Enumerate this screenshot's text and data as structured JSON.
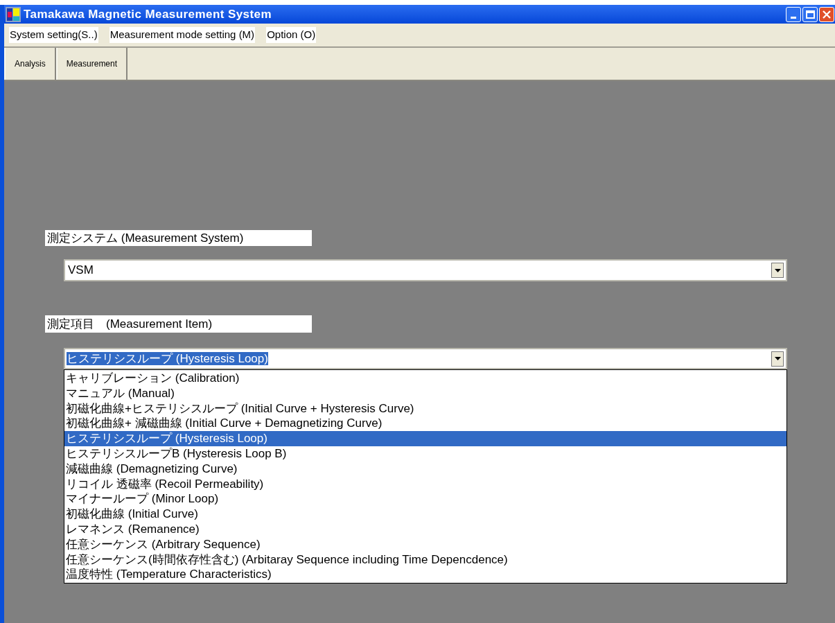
{
  "window": {
    "title": "Tamakawa Magnetic Measurement System"
  },
  "menu": [
    "System setting(S..)",
    "Measurement mode setting (M)",
    "Option (O)"
  ],
  "toolbar": [
    {
      "label": "Analysis",
      "selected": false
    },
    {
      "label": "Measurement",
      "selected": false
    }
  ],
  "measurement_system": {
    "label": "測定システム (Measurement System)",
    "value": "VSM"
  },
  "measurement_item": {
    "label": "測定項目　(Measurement Item)",
    "value": "ヒステリシスループ (Hysteresis Loop)",
    "expanded": true,
    "options": [
      {
        "label": "キャリブレーション (Calibration)",
        "selected": false
      },
      {
        "label": "マニュアル (Manual)",
        "selected": false
      },
      {
        "label": "初磁化曲線+ヒステリシスループ (Initial Curve + Hysteresis Curve)",
        "selected": false
      },
      {
        "label": "初磁化曲線+ 減磁曲線 (Initial Curve + Demagnetizing Curve)",
        "selected": false
      },
      {
        "label": "ヒステリシスループ (Hysteresis Loop)",
        "selected": true
      },
      {
        "label": "ヒステリシスループB (Hysteresis Loop B)",
        "selected": false
      },
      {
        "label": "減磁曲線 (Demagnetizing Curve)",
        "selected": false
      },
      {
        "label": "リコイル 透磁率 (Recoil Permeability)",
        "selected": false
      },
      {
        "label": "マイナーループ (Minor Loop)",
        "selected": false
      },
      {
        "label": "初磁化曲線 (Initial Curve)",
        "selected": false
      },
      {
        "label": "レマネンス (Remanence)",
        "selected": false
      },
      {
        "label": "任意シーケンス (Arbitrary Sequence)",
        "selected": false
      },
      {
        "label": "任意シーケンス(時間依存性含む) (Arbitaray Sequence including Time Depencdence)",
        "selected": false
      },
      {
        "label": "温度特性 (Temperature Characteristics)",
        "selected": false
      }
    ]
  }
}
